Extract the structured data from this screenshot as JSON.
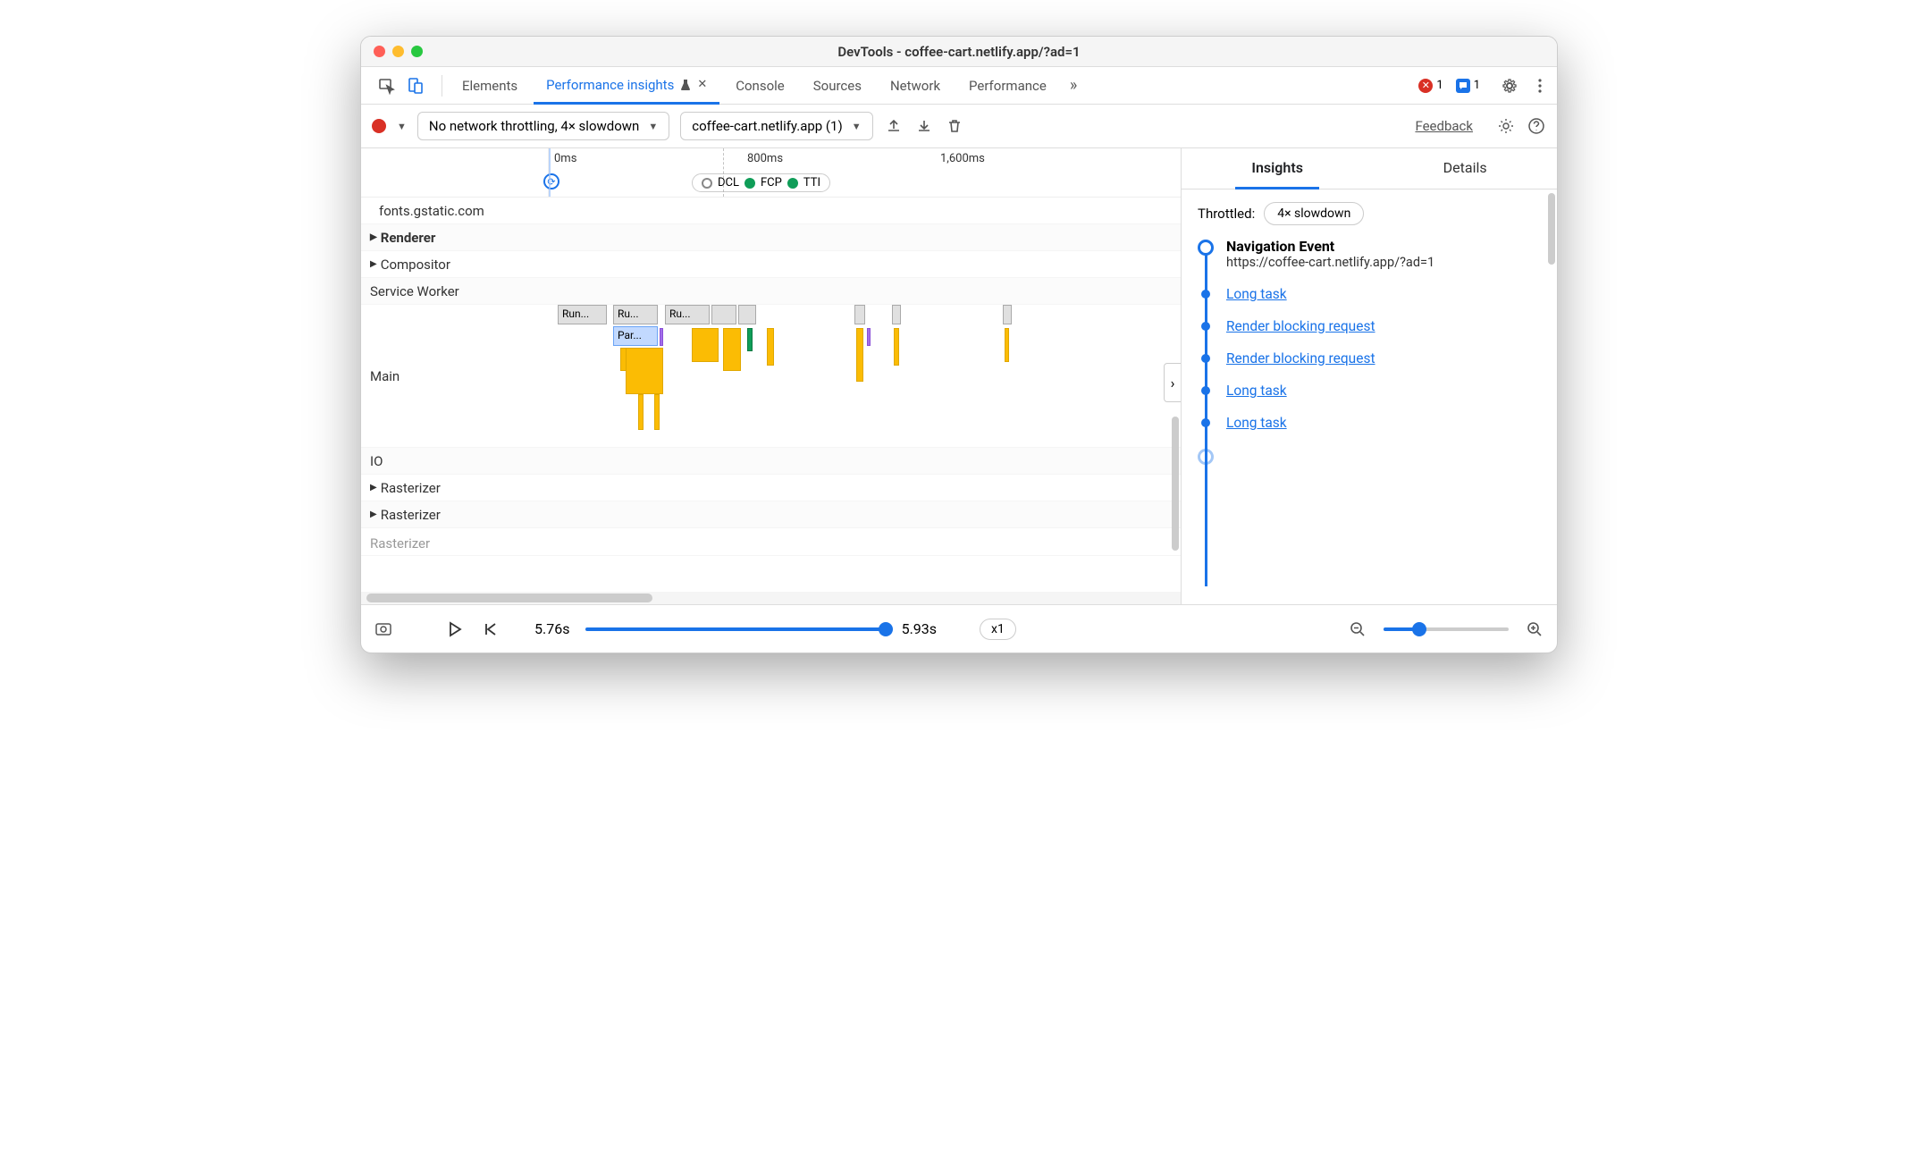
{
  "window_title": "DevTools - coffee-cart.netlify.app/?ad=1",
  "tabs": {
    "items": [
      "Elements",
      "Performance insights",
      "Console",
      "Sources",
      "Network",
      "Performance"
    ],
    "active_index": 1,
    "close_glyph": "✕",
    "more_glyph": "»",
    "error_count": "1",
    "message_count": "1"
  },
  "toolbar": {
    "throttle_select": "No network throttling, 4× slowdown",
    "page_select": "coffee-cart.netlify.app (1)",
    "feedback": "Feedback"
  },
  "timeline": {
    "ticks": [
      "0ms",
      "800ms",
      "1,600ms"
    ],
    "markers": [
      "DCL",
      "FCP",
      "TTI"
    ],
    "rows": [
      {
        "label": "fonts.gstatic.com",
        "indent": 1
      },
      {
        "label": "Renderer",
        "bold": true,
        "caret": true
      },
      {
        "label": "Compositor",
        "caret": true
      },
      {
        "label": "Service Worker"
      },
      {
        "label": "Main"
      },
      {
        "label": "IO"
      },
      {
        "label": "Rasterizer",
        "caret": true
      },
      {
        "label": "Rasterizer",
        "caret": true
      },
      {
        "label": "Rasterizer"
      }
    ],
    "main_blocks": [
      "Run...",
      "Ru...",
      "Ru..."
    ],
    "parse_block": "Par..."
  },
  "right_panel": {
    "tabs": [
      "Insights",
      "Details"
    ],
    "active_index": 0,
    "throttled_label": "Throttled:",
    "throttled_value": "4× slowdown",
    "nav_title": "Navigation Event",
    "nav_url": "https://coffee-cart.netlify.app/?ad=1",
    "items": [
      "Long task",
      "Render blocking request",
      "Render blocking request",
      "Long task",
      "Long task"
    ]
  },
  "footer": {
    "time_current": "5.76s",
    "time_end": "5.93s",
    "speed": "x1"
  }
}
